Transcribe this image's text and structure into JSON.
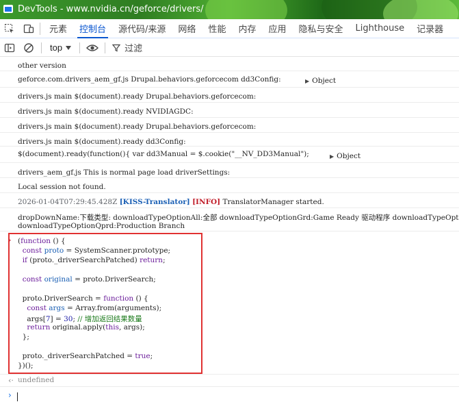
{
  "window": {
    "title": "DevTools - www.nvidia.cn/geforce/drivers/"
  },
  "tabs": [
    {
      "label": "元素",
      "active": false
    },
    {
      "label": "控制台",
      "active": true
    },
    {
      "label": "源代码/来源",
      "active": false
    },
    {
      "label": "网络",
      "active": false
    },
    {
      "label": "性能",
      "active": false
    },
    {
      "label": "内存",
      "active": false
    },
    {
      "label": "应用",
      "active": false
    },
    {
      "label": "隐私与安全",
      "active": false
    },
    {
      "label": "Lighthouse",
      "active": false
    },
    {
      "label": "记录器",
      "active": false
    }
  ],
  "console_toolbar": {
    "context": "top",
    "filter_label": "过滤"
  },
  "logs": [
    {
      "text": "other version"
    },
    {
      "text": "geforce.com.drivers_aem_gf.js Drupal.behaviors.geforcecom dd3Config:",
      "object": "Object"
    },
    {
      "text": "drivers.js main $(document).ready Drupal.behaviors.geforcecom:"
    },
    {
      "text": "drivers.js main $(document).ready NVIDIAGDC:"
    },
    {
      "text": "drivers.js main $(document).ready Drupal.behaviors.geforcecom:"
    },
    {
      "text": "drivers.js main $(document).ready dd3Config:"
    },
    {
      "text": "$(document).ready(function(){ var dd3Manual = $.cookie(\"__NV_DD3Manual\");",
      "object": "Object"
    },
    {
      "text": "drivers_aem_gf.js This is normal page load driverSettings:"
    },
    {
      "text": "Local session not found."
    },
    {
      "timestamp": "2026-01-04T07:29:45.428Z",
      "tag1": "[KISS-Translator]",
      "tag2": "[INFO]",
      "text": "TranslatorManager started."
    },
    {
      "line1": "dropDownName:下载类型: downloadTypeOptionAll:全部 downloadTypeOptionGrd:Game Ready 驱动程序  downloadTypeOpt",
      "line2": "downloadTypeOptionQprd:Production Branch"
    }
  ],
  "code_lines": [
    "(function () {",
    "  const proto = SystemScanner.prototype;",
    "  if (proto._driverSearchPatched) return;",
    "",
    "  const original = proto.DriverSearch;",
    "",
    "  proto.DriverSearch = function () {",
    "    const args = Array.from(arguments);",
    "    args[7] = 30; // 增加返回结果数量",
    "    return original.apply(this, args);",
    "  };",
    "",
    "  proto._driverSearchPatched = true;",
    "})();"
  ],
  "result": "undefined",
  "colors": {
    "accent": "#0b57d0",
    "highlight_border": "#e03131",
    "kiss": "#1a5fb4",
    "info": "#c01c28"
  }
}
